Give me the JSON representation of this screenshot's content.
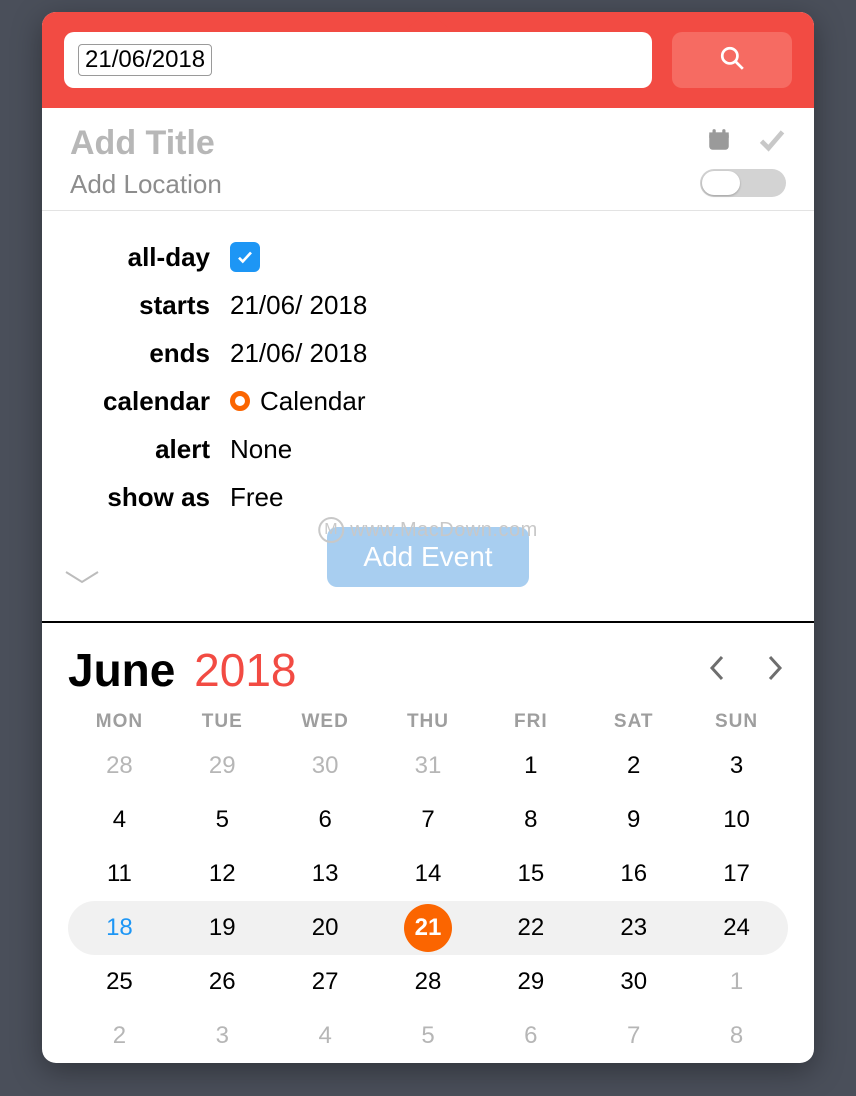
{
  "header": {
    "search_value": "21/06/2018"
  },
  "event": {
    "title_placeholder": "Add Title",
    "location_placeholder": "Add Location"
  },
  "details": {
    "allday_label": "all-day",
    "allday_checked": true,
    "starts_label": "starts",
    "starts_value": "21/06/ 2018",
    "ends_label": "ends",
    "ends_value": "21/06/ 2018",
    "calendar_label": "calendar",
    "calendar_value": "Calendar",
    "alert_label": "alert",
    "alert_value": "None",
    "showas_label": "show as",
    "showas_value": "Free"
  },
  "actions": {
    "add_event": "Add Event"
  },
  "watermark": "www.MacDown.com",
  "month": {
    "name": "June",
    "year": "2018",
    "weekdays": [
      "MON",
      "TUE",
      "WED",
      "THU",
      "FRI",
      "SAT",
      "SUN"
    ],
    "weeks": [
      [
        {
          "n": "28",
          "other": true
        },
        {
          "n": "29",
          "other": true
        },
        {
          "n": "30",
          "other": true
        },
        {
          "n": "31",
          "other": true
        },
        {
          "n": "1"
        },
        {
          "n": "2"
        },
        {
          "n": "3"
        }
      ],
      [
        {
          "n": "4"
        },
        {
          "n": "5"
        },
        {
          "n": "6"
        },
        {
          "n": "7"
        },
        {
          "n": "8"
        },
        {
          "n": "9"
        },
        {
          "n": "10"
        }
      ],
      [
        {
          "n": "11"
        },
        {
          "n": "12"
        },
        {
          "n": "13"
        },
        {
          "n": "14"
        },
        {
          "n": "15"
        },
        {
          "n": "16"
        },
        {
          "n": "17"
        }
      ],
      [
        {
          "n": "18",
          "today": true
        },
        {
          "n": "19"
        },
        {
          "n": "20"
        },
        {
          "n": "21",
          "selected": true
        },
        {
          "n": "22"
        },
        {
          "n": "23"
        },
        {
          "n": "24"
        }
      ],
      [
        {
          "n": "25"
        },
        {
          "n": "26"
        },
        {
          "n": "27"
        },
        {
          "n": "28"
        },
        {
          "n": "29"
        },
        {
          "n": "30"
        },
        {
          "n": "1",
          "other": true
        }
      ],
      [
        {
          "n": "2",
          "other": true
        },
        {
          "n": "3",
          "other": true
        },
        {
          "n": "4",
          "other": true
        },
        {
          "n": "5",
          "other": true
        },
        {
          "n": "6",
          "other": true
        },
        {
          "n": "7",
          "other": true
        },
        {
          "n": "8",
          "other": true
        }
      ]
    ],
    "highlight_week_index": 3
  }
}
